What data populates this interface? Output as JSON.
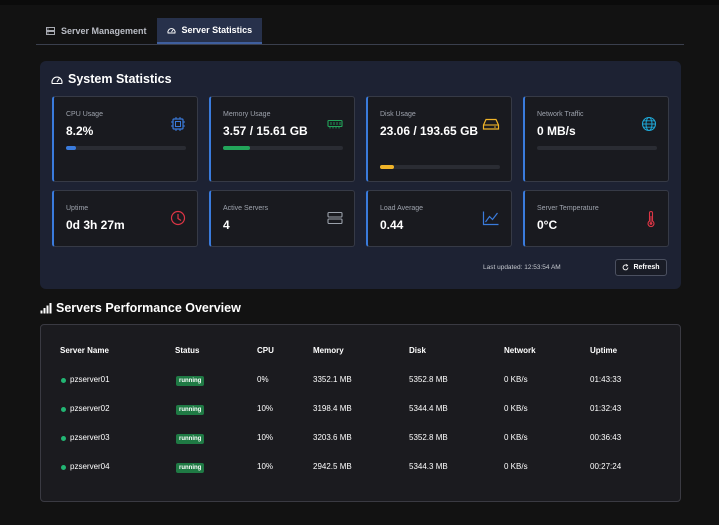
{
  "tabs": [
    {
      "label": "Server Management",
      "icon": "server-icon",
      "active": false
    },
    {
      "label": "Server Statistics",
      "icon": "gauge-icon",
      "active": true
    }
  ],
  "system_stats": {
    "title": "System Statistics",
    "cards": [
      {
        "label": "CPU Usage",
        "value": "8.2%",
        "icon": "cpu-icon",
        "color": "#3a7bdc",
        "progress": 0.082
      },
      {
        "label": "Memory Usage",
        "value": "3.57 / 15.61 GB",
        "icon": "memory-icon",
        "color": "#22a55a",
        "progress": 0.229
      },
      {
        "label": "Disk Usage",
        "value": "23.06 / 193.65 GB",
        "icon": "hard-drive-icon",
        "color": "#f0b429",
        "progress": 0.119
      },
      {
        "label": "Network Traffic",
        "value": "0 MB/s",
        "icon": "globe-icon",
        "color": "#1ea7d6",
        "progress": 0
      },
      {
        "label": "Uptime",
        "value": "0d 3h 27m",
        "icon": "clock-icon",
        "color": "#dc3545"
      },
      {
        "label": "Active Servers",
        "value": "4",
        "icon": "server-stack-icon",
        "color": "#9aa0aa"
      },
      {
        "label": "Load Average",
        "value": "0.44",
        "icon": "chart-line-icon",
        "color": "#3a7bdc"
      },
      {
        "label": "Server Temperature",
        "value": "0°C",
        "icon": "thermometer-icon",
        "color": "#dc3545"
      }
    ],
    "last_updated": "Last updated: 12:53:54 AM",
    "refresh_label": "Refresh"
  },
  "overview": {
    "title": "Servers Performance Overview",
    "columns": [
      "Server Name",
      "Status",
      "CPU",
      "Memory",
      "Disk",
      "Network",
      "Uptime"
    ],
    "rows": [
      {
        "name": "pzserver01",
        "status": "running",
        "cpu": "0%",
        "memory": "3352.1 MB",
        "disk": "5352.8 MB",
        "network": "0 KB/s",
        "uptime": "01:43:33"
      },
      {
        "name": "pzserver02",
        "status": "running",
        "cpu": "10%",
        "memory": "3198.4 MB",
        "disk": "5344.4 MB",
        "network": "0 KB/s",
        "uptime": "01:32:43"
      },
      {
        "name": "pzserver03",
        "status": "running",
        "cpu": "10%",
        "memory": "3203.6 MB",
        "disk": "5352.8 MB",
        "network": "0 KB/s",
        "uptime": "00:36:43"
      },
      {
        "name": "pzserver04",
        "status": "running",
        "cpu": "10%",
        "memory": "2942.5 MB",
        "disk": "5344.3 MB",
        "network": "0 KB/s",
        "uptime": "00:27:24"
      }
    ]
  }
}
